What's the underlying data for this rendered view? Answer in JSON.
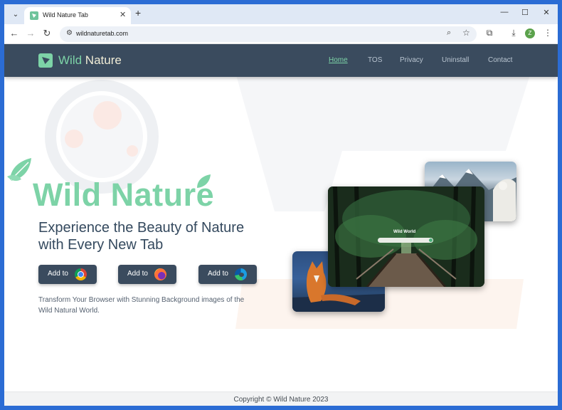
{
  "browser": {
    "tab_title": "Wild Nature Tab",
    "url": "wildnaturetab.com",
    "profile_initial": "Z"
  },
  "site": {
    "logo": {
      "word1": "Wild",
      "word2": "Nature"
    },
    "nav": [
      {
        "label": "Home",
        "active": true
      },
      {
        "label": "TOS"
      },
      {
        "label": "Privacy"
      },
      {
        "label": "Uninstall"
      },
      {
        "label": "Contact"
      }
    ],
    "hero": {
      "title": "Wild Nature",
      "subtitle": "Experience the Beauty of Nature with Every New Tab",
      "buttons": [
        {
          "label": "Add to",
          "browser": "chrome-logo-icon"
        },
        {
          "label": "Add to",
          "browser": "firefox-logo-icon"
        },
        {
          "label": "Add to",
          "browser": "edge-logo-icon"
        }
      ],
      "description": "Transform Your Browser with Stunning Background images of the Wild Natural World.",
      "preview_label": "Wild World"
    },
    "footer": {
      "copyright": "Copyright © Wild Nature 2023"
    }
  },
  "colors": {
    "header_bg": "#3a4b5e",
    "brand_green": "#7dd3a7",
    "text_dark": "#34495e",
    "browser_frame": "#2b6cd4"
  }
}
